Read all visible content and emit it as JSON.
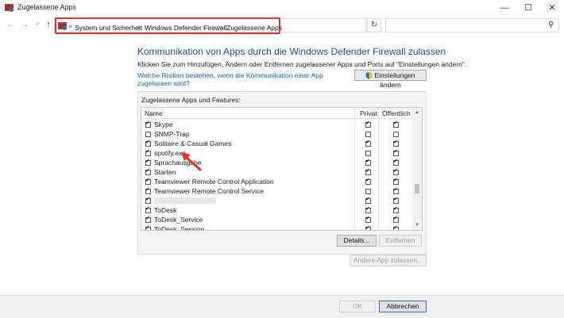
{
  "window": {
    "title": "Zugelassene Apps",
    "controls": [
      "minimize-icon",
      "maximize-icon",
      "close-icon"
    ]
  },
  "address_bar": {
    "prefix": "«",
    "breadcrumbs": [
      "System und Sicherheit",
      "Windows Defender Firewall",
      "Zugelassene Apps"
    ],
    "separator": "›",
    "search_placeholder": ""
  },
  "main": {
    "heading": "Kommunikation von Apps durch die Windows Defender Firewall zulassen",
    "subtext": "Klicken Sie zum Hinzufügen, Ändern oder Entfernen zugelassener Apps und Ports auf \"Einstellungen ändern\".",
    "risk_link": "Welche Risiken bestehen, wenn die Kommunikation einer App zugelassen wird?",
    "settings_button": "Einstellungen ändern",
    "group_label": "Zugelassene Apps und Features:",
    "columns": {
      "name": "Name",
      "private": "Privat",
      "public": "Öffentlich"
    },
    "apps": [
      {
        "name": "Skype",
        "enabled": true,
        "private": true,
        "public": true
      },
      {
        "name": "SNMP-Trap",
        "enabled": false,
        "private": false,
        "public": false
      },
      {
        "name": "Solitaire & Casual Games",
        "enabled": true,
        "private": true,
        "public": true
      },
      {
        "name": "spotify.exe",
        "enabled": true,
        "private": false,
        "public": true
      },
      {
        "name": "Sprachausgabe",
        "enabled": true,
        "private": true,
        "public": true
      },
      {
        "name": "Starten",
        "enabled": true,
        "private": true,
        "public": true
      },
      {
        "name": "Teamviewer Remote Control Application",
        "enabled": true,
        "private": true,
        "public": true
      },
      {
        "name": "Teamviewer Remote Control Service",
        "enabled": true,
        "private": false,
        "public": true
      },
      {
        "name": "",
        "enabled": true,
        "private": true,
        "public": true,
        "redacted": true
      },
      {
        "name": "ToDesk",
        "enabled": true,
        "private": true,
        "public": true
      },
      {
        "name": "ToDesk_Service",
        "enabled": true,
        "private": true,
        "public": true
      },
      {
        "name": "ToDesk_Session",
        "enabled": true,
        "private": true,
        "public": true
      }
    ],
    "details_button": "Details...",
    "remove_button": "Entfernen",
    "allow_other_button": "Andere App zulassen..."
  },
  "footer": {
    "ok_button": "OK",
    "cancel_button": "Abbrechen"
  },
  "colors": {
    "accent_heading": "#1e4d9b",
    "link": "#1166cc",
    "annotation": "#e0322f"
  }
}
